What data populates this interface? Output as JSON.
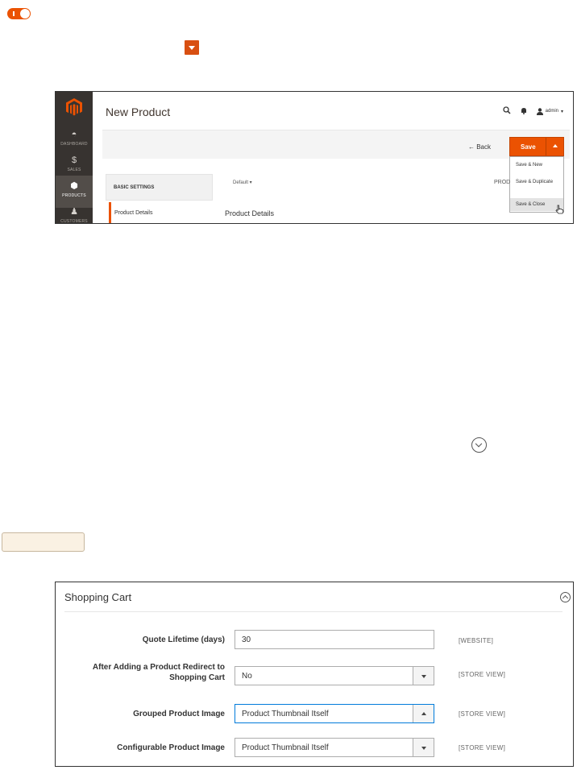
{
  "doc": {
    "toggle_icon": "toggle-icon",
    "dropdown_icon": "chevron-down-icon",
    "expand_icon": "chevron-down-circle-icon"
  },
  "shot1": {
    "sidebar": [
      {
        "label": "DASHBOARD",
        "icon": "dashboard-icon"
      },
      {
        "label": "SALES",
        "icon": "dollar-icon"
      },
      {
        "label": "PRODUCTS",
        "icon": "cube-icon"
      },
      {
        "label": "CUSTOMERS",
        "icon": "person-icon"
      }
    ],
    "page_title": "New Product",
    "user": "admin",
    "back_label": "← Back",
    "save_label": "Save",
    "save_menu": [
      "Save & New",
      "Save & Duplicate",
      "Save & Close"
    ],
    "basic_settings": "BASIC SETTINGS",
    "scope_label": "Default",
    "prod_label": "PROD",
    "product_details_nav": "Product Details",
    "product_details_title": "Product Details",
    "accent": "#eb5202"
  },
  "shot2": {
    "title": "Shopping Cart",
    "rows": [
      {
        "label": "Quote Lifetime (days)",
        "value": "30",
        "scope": "[WEBSITE]",
        "type": "text"
      },
      {
        "label": "After Adding a Product Redirect to Shopping Cart",
        "value": "No",
        "scope": "[STORE VIEW]",
        "type": "select"
      },
      {
        "label": "Grouped Product Image",
        "value": "Product Thumbnail Itself",
        "scope": "[STORE VIEW]",
        "type": "select-open"
      },
      {
        "label": "Configurable Product Image",
        "value": "Product Thumbnail Itself",
        "scope": "[STORE VIEW]",
        "type": "select"
      }
    ]
  }
}
